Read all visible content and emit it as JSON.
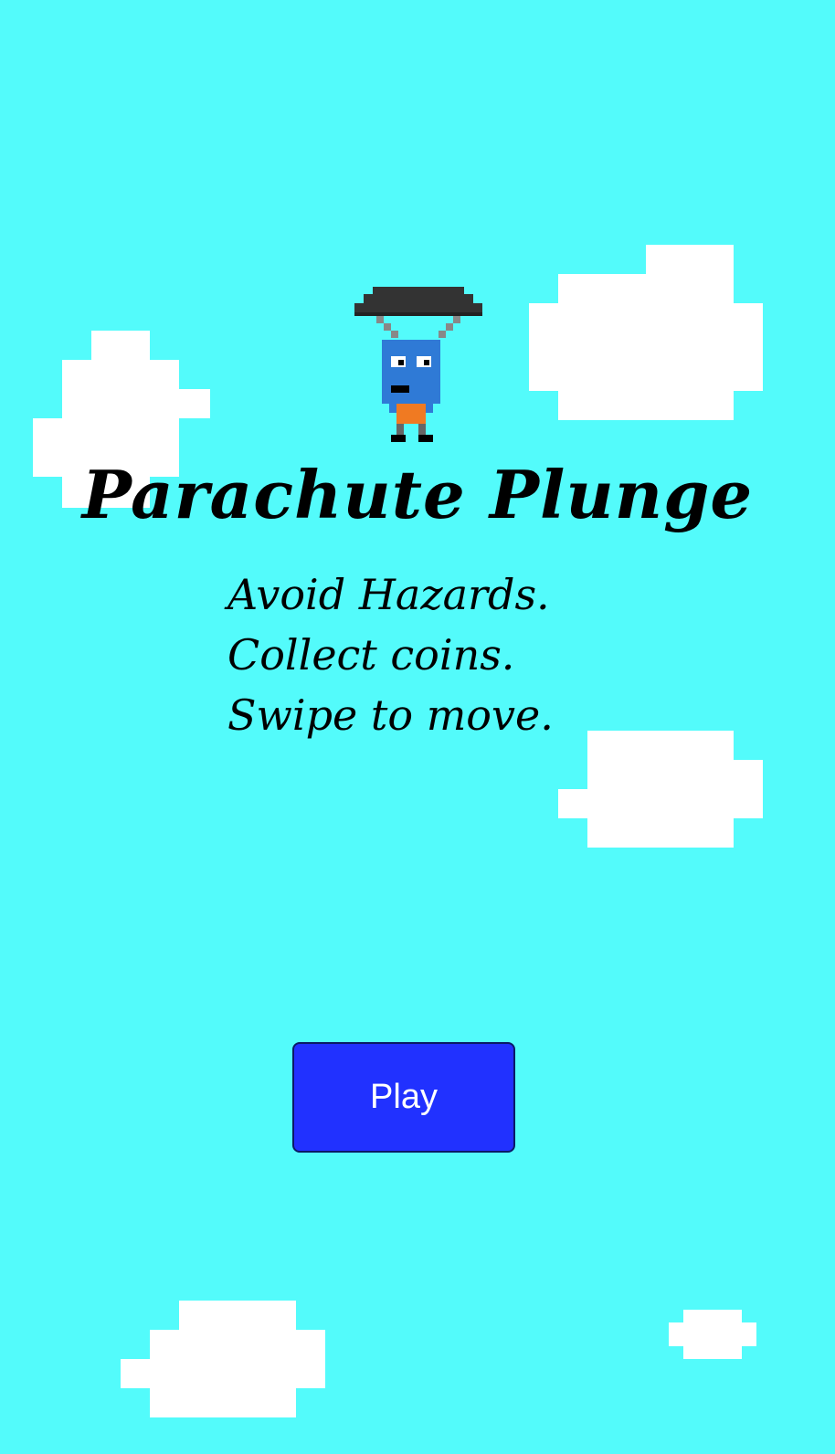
{
  "game": {
    "title": "Parachute Plunge",
    "instructions": [
      "Avoid Hazards.",
      "Collect coins.",
      "Swipe to move."
    ],
    "play_label": "Play"
  },
  "colors": {
    "sky": "#53fbfb",
    "cloud": "#ffffff",
    "button": "#2131ff",
    "button_text": "#ffffff",
    "title_text": "#000000",
    "parachute": "#333333",
    "character_body": "#2f7ad6",
    "character_shirt": "#f07a22"
  },
  "icons": {
    "character": "parachuting-robot-icon",
    "clouds": "pixel-cloud-icon"
  }
}
